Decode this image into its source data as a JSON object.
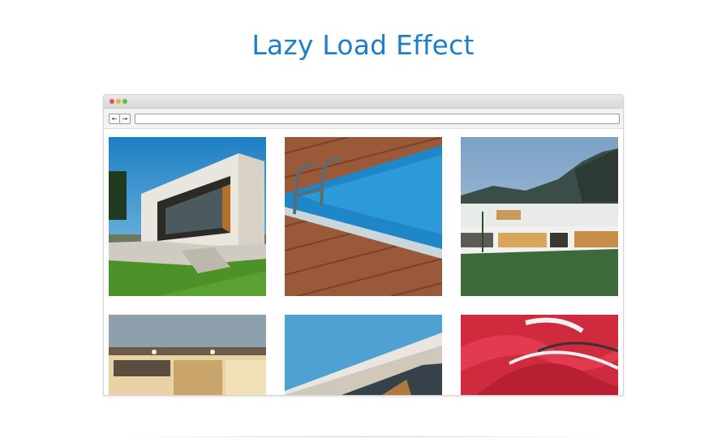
{
  "page": {
    "title": "Lazy Load Effect"
  },
  "browser": {
    "window_controls": [
      "close",
      "minimize",
      "maximize"
    ],
    "nav": {
      "back_icon": "arrow-left-icon",
      "back_glyph": "←",
      "forward_icon": "arrow-right-icon",
      "forward_glyph": "→"
    },
    "address_value": ""
  },
  "gallery": {
    "images": [
      {
        "subject": "modern-house-lawn"
      },
      {
        "subject": "pool-ladder-deck"
      },
      {
        "subject": "house-mountains"
      },
      {
        "subject": "house-interior-lights"
      },
      {
        "subject": "house-roof-sky"
      },
      {
        "subject": "red-abstract-facade"
      }
    ]
  },
  "colors": {
    "title": "#1d7fc9",
    "window_chrome": "#e0e0e0"
  }
}
